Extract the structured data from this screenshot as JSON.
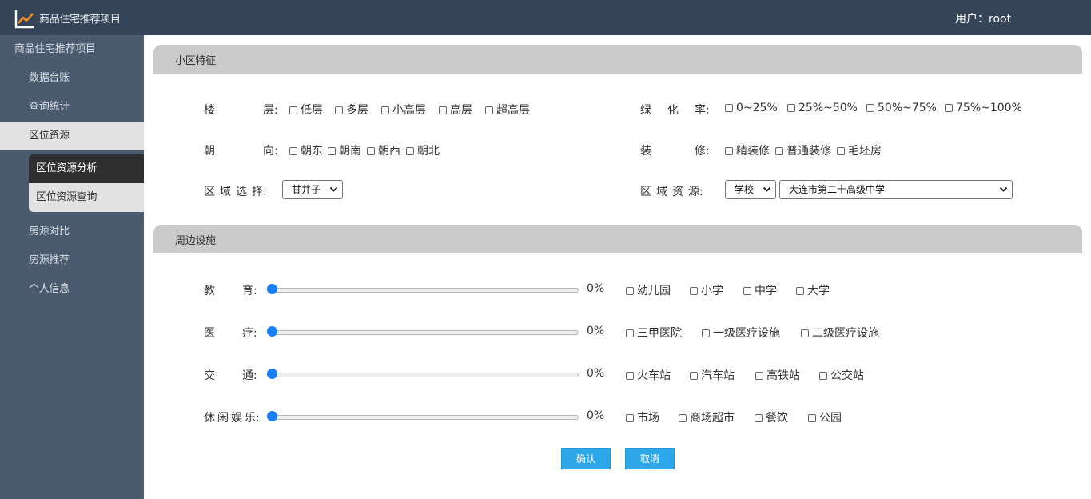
{
  "header": {
    "app_title": "商品住宅推荐项目",
    "user": "用户：root"
  },
  "sidebar": {
    "root": "商品住宅推荐项目",
    "items": [
      "数据台账",
      "查询统计",
      "区位资源"
    ],
    "sub_items": [
      "区位资源分析",
      "区位资源查询"
    ],
    "items_after": [
      "房源对比",
      "房源推荐",
      "个人信息"
    ]
  },
  "section1": {
    "title": "小区特征",
    "floor": {
      "label": [
        "楼",
        "层:"
      ],
      "options": [
        "低层",
        "多层",
        "小高层",
        "高层",
        "超高层"
      ]
    },
    "green": {
      "label": [
        "绿",
        "化",
        "率:"
      ],
      "options": [
        "0~25%",
        "25%~50%",
        "50%~75%",
        "75%~100%"
      ]
    },
    "orientation": {
      "label": [
        "朝",
        "向:"
      ],
      "options": [
        "朝东",
        "朝南",
        "朝西",
        "朝北"
      ]
    },
    "decoration": {
      "label": [
        "装",
        "修:"
      ],
      "options": [
        "精装修",
        "普通装修",
        "毛坯房"
      ]
    },
    "region": {
      "label": [
        "区",
        "域",
        "选",
        "择:"
      ],
      "value": "甘井子"
    },
    "resource": {
      "label": [
        "区",
        "域",
        "资",
        "源:"
      ],
      "type_value": "学校",
      "name_value": "大连市第二十高级中学"
    }
  },
  "section2": {
    "title": "周边设施",
    "rows": [
      {
        "label": [
          "教",
          "育:"
        ],
        "value": 0,
        "percent": "0%",
        "options": [
          "幼儿园",
          "小学",
          "中学",
          "大学"
        ]
      },
      {
        "label": [
          "医",
          "疗:"
        ],
        "value": 0,
        "percent": "0%",
        "options": [
          "三甲医院",
          "一级医疗设施",
          "二级医疗设施"
        ]
      },
      {
        "label": [
          "交",
          "通:"
        ],
        "value": 0,
        "percent": "0%",
        "options": [
          "火车站",
          "汽车站",
          "高铁站",
          "公交站"
        ]
      },
      {
        "label": [
          "休",
          "闲",
          "娱",
          "乐:"
        ],
        "value": 0,
        "percent": "0%",
        "options": [
          "市场",
          "商场超市",
          "餐饮",
          "公园"
        ]
      }
    ]
  },
  "buttons": {
    "confirm": "确认",
    "cancel": "取消"
  },
  "colors": {
    "topbar": "#364459",
    "sidebar": "#4b5b6f",
    "accent": "#2ea6e8",
    "slider": "#1a7df3"
  }
}
